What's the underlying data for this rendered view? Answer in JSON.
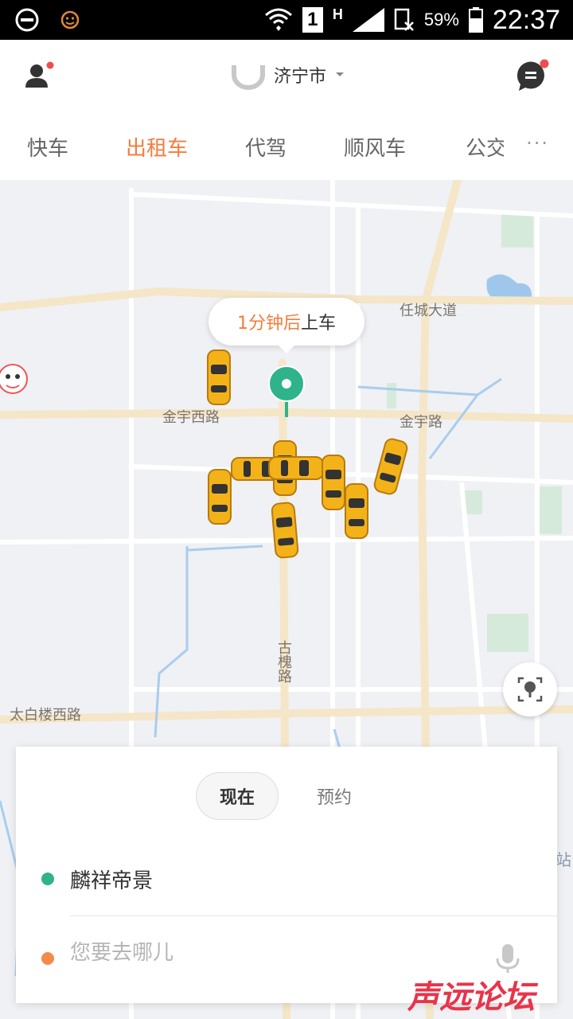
{
  "status_bar": {
    "network_label": "1",
    "h_label": "H",
    "battery_percent": "59%",
    "time": "22:37"
  },
  "header": {
    "city": "济宁市"
  },
  "tabs": [
    {
      "label": "快车",
      "active": false
    },
    {
      "label": "出租车",
      "active": true
    },
    {
      "label": "代驾",
      "active": false
    },
    {
      "label": "顺风车",
      "active": false
    },
    {
      "label": "公交",
      "active": false
    }
  ],
  "tabs_more": "···",
  "map": {
    "eta_highlight": "1分钟后",
    "eta_suffix": "上车",
    "road_labels": {
      "rencheng": "任城大道",
      "jinyu_west": "金宇西路",
      "jinyu": "金宇路",
      "guhuai": "古槐路",
      "taibailou_west": "太白楼西路",
      "station_partial": "站"
    }
  },
  "booking": {
    "now_label": "现在",
    "reserve_label": "预约",
    "pickup": "麟祥帝景",
    "destination_placeholder": "您要去哪儿"
  },
  "watermark": "声远论坛",
  "colors": {
    "accent": "#f57c3b",
    "pickup_green": "#2fb38b",
    "dest_orange": "#f58b4a",
    "taxi_yellow": "#f3b318"
  }
}
